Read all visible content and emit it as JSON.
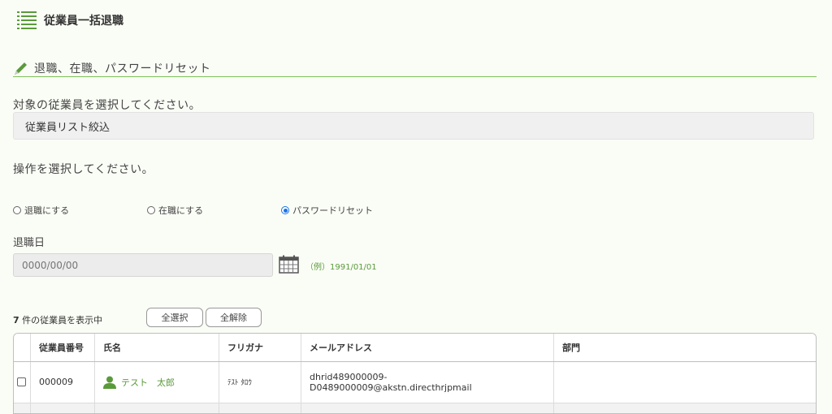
{
  "header": {
    "title": "従業員一括退職",
    "icon": "list-icon",
    "accent": "#5a9a3a"
  },
  "section": {
    "title": "退職、在職、パスワードリセット",
    "icon": "pencil-icon"
  },
  "target": {
    "label": "対象の従業員を選択してください。",
    "filter_label": "従業員リスト絞込"
  },
  "operation": {
    "label": "操作を選択してください。",
    "options": [
      {
        "label": "退職にする",
        "checked": false
      },
      {
        "label": "在職にする",
        "checked": false
      },
      {
        "label": "パスワードリセット",
        "checked": true
      }
    ]
  },
  "retire_date": {
    "label": "退職日",
    "placeholder": "0000/00/00",
    "value": "",
    "example": "（例）1991/01/01"
  },
  "list": {
    "count": "7",
    "count_suffix": " 件の従業員を表示中",
    "select_all_label": "全選択",
    "clear_all_label": "全解除",
    "columns": [
      "従業員番号",
      "氏名",
      "フリガナ",
      "メールアドレス",
      "部門"
    ],
    "rows": [
      {
        "id": "000009",
        "name": "テスト　太郎",
        "kana": "ﾃｽﾄ ﾀﾛｳ",
        "email": "dhrid489000009-D0489000009@akstn.directhrjpmail",
        "dept": ""
      }
    ]
  }
}
